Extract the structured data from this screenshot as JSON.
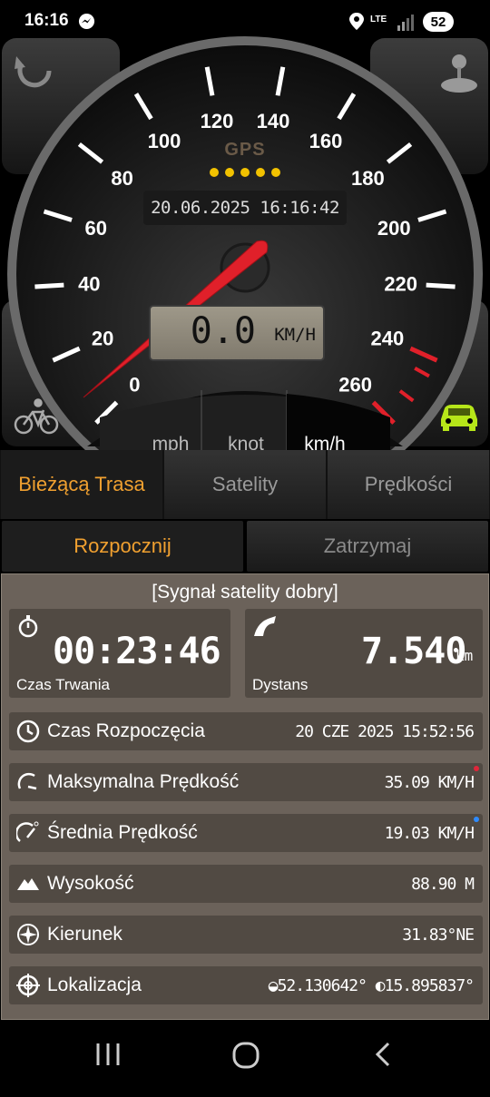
{
  "status_bar": {
    "time": "16:16",
    "network": "LTE",
    "battery": "52"
  },
  "gauge": {
    "gps_label": "GPS",
    "datetime": "20.06.2025 16:16:42",
    "speed_value": "0.0",
    "speed_unit": "km/h",
    "scale_labels": [
      "0",
      "20",
      "40",
      "60",
      "80",
      "100",
      "120",
      "140",
      "160",
      "180",
      "200",
      "220",
      "240",
      "260"
    ],
    "needle_value": 0
  },
  "unit_selector": {
    "mph": "mph",
    "knot": "knot",
    "kmh": "km/h",
    "selected": "km/h"
  },
  "tabs": [
    {
      "label": "Bieżącą Trasa",
      "active": true
    },
    {
      "label": "Satelity",
      "active": false
    },
    {
      "label": "Prędkości",
      "active": false
    }
  ],
  "actions": {
    "start": "Rozpocznij",
    "stop": "Zatrzymaj"
  },
  "panel": {
    "signal": "[Sygnał satelity dobry]",
    "duration": {
      "value": "00:23:46",
      "label": "Czas Trwania"
    },
    "distance": {
      "value": "7.540",
      "unit": "km",
      "label": "Dystans"
    },
    "rows": [
      {
        "label": "Czas Rozpoczęcia",
        "value": "20 CZE 2025 15:52:56",
        "icon": "clock-icon"
      },
      {
        "label": "Maksymalna Prędkość",
        "value": "35.09 KM/H",
        "icon": "max-speed-icon",
        "dot": "#e0263a"
      },
      {
        "label": "Średnia Prędkość",
        "value": "19.03 KM/H",
        "icon": "avg-speed-icon",
        "dot": "#2e8bff"
      },
      {
        "label": "Wysokość",
        "value": "88.90 M",
        "icon": "mountain-icon"
      },
      {
        "label": "Kierunek",
        "value": "31.83°NE",
        "icon": "compass-icon"
      },
      {
        "label": "Lokalizacja",
        "value": "◒52.130642° ◐15.895837°",
        "icon": "crosshair-icon"
      }
    ]
  },
  "colors": {
    "accent": "#f0a030",
    "needle": "#e0202a",
    "panel_bg": "#6b625a",
    "box_bg": "#514a43",
    "car_icon": "#b6e619"
  }
}
